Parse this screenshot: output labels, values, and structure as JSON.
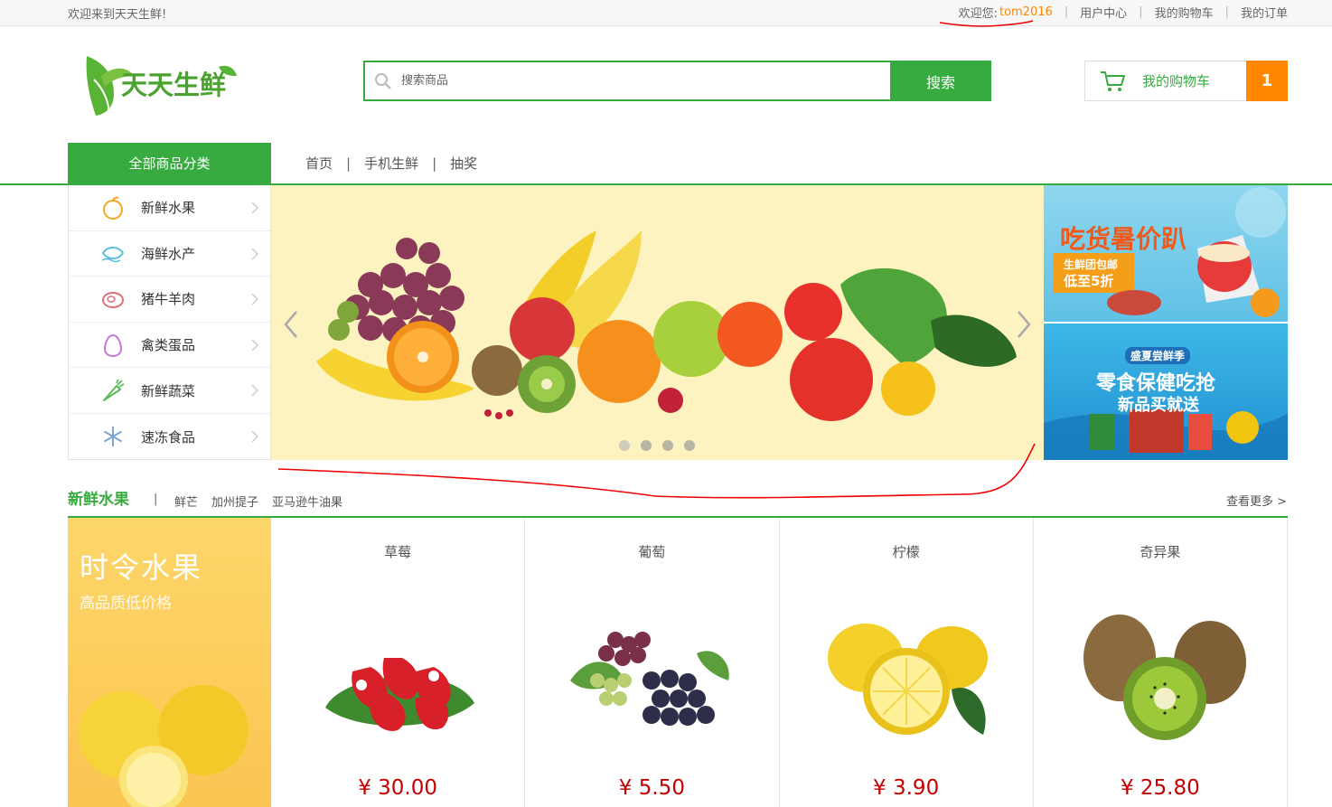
{
  "topbar": {
    "welcome": "欢迎来到天天生鲜!",
    "greet": "欢迎您:",
    "username": "tom2016",
    "links": [
      "用户中心",
      "我的购物车",
      "我的订单"
    ]
  },
  "header": {
    "logo_text": "天天生鲜",
    "search_placeholder": "搜索商品",
    "search_button": "搜索",
    "cart_label": "我的购物车",
    "cart_count": "1"
  },
  "nav": {
    "all_categories": "全部商品分类",
    "links": [
      "首页",
      "手机生鲜",
      "抽奖"
    ]
  },
  "categories": [
    {
      "label": "新鲜水果",
      "icon": "orange-icon"
    },
    {
      "label": "海鲜水产",
      "icon": "seafood-icon"
    },
    {
      "label": "猪牛羊肉",
      "icon": "meat-icon"
    },
    {
      "label": "禽类蛋品",
      "icon": "egg-icon"
    },
    {
      "label": "新鲜蔬菜",
      "icon": "carrot-icon"
    },
    {
      "label": "速冻食品",
      "icon": "snowflake-icon"
    }
  ],
  "ads": {
    "ad1_title": "吃货暑价趴",
    "ad1_sub1": "生鲜团包邮",
    "ad1_sub2": "低至5折",
    "ad2_tag": "盛夏尝鲜季",
    "ad2_title": "零食保健吃抢",
    "ad2_sub": "新品买就送"
  },
  "section": {
    "title": "新鲜水果",
    "sub_links": [
      "鲜芒",
      "加州提子",
      "亚马逊牛油果"
    ],
    "more": "查看更多 >",
    "promo_title": "时令水果",
    "promo_sub": "高品质低价格"
  },
  "products": [
    {
      "name": "草莓",
      "price": "¥ 30.00"
    },
    {
      "name": "葡萄",
      "price": "¥ 5.50"
    },
    {
      "name": "柠檬",
      "price": "¥ 3.90"
    },
    {
      "name": "奇异果",
      "price": "¥ 25.80"
    }
  ],
  "colors": {
    "brand_green": "#37ab40",
    "accent_orange": "#ff8800",
    "price_red": "#c40000"
  }
}
